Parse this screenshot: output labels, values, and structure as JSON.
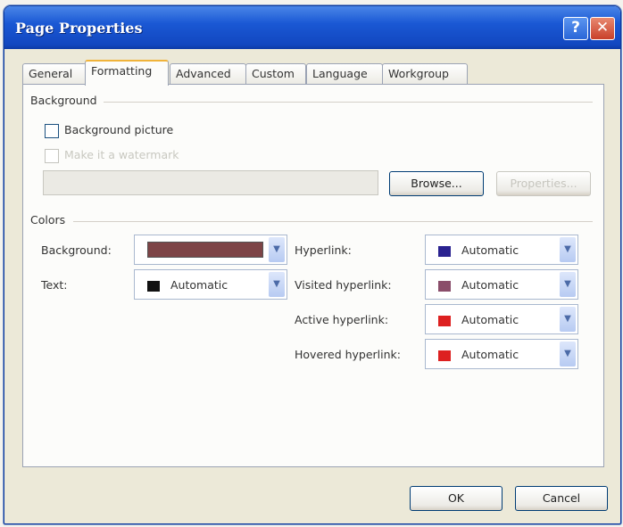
{
  "window": {
    "title": "Page Properties",
    "help": "?",
    "close": "✕"
  },
  "tabs": [
    "General",
    "Formatting",
    "Advanced",
    "Custom",
    "Language",
    "Workgroup"
  ],
  "active_tab": "Formatting",
  "background": {
    "group_label": "Background",
    "picture_checkbox": "Background picture",
    "watermark_checkbox": "Make it a watermark",
    "browse_button": "Browse...",
    "properties_button": "Properties..."
  },
  "colors": {
    "group_label": "Colors",
    "background_label": "Background:",
    "text_label": "Text:",
    "text_value": "Automatic",
    "hyperlink_label": "Hyperlink:",
    "hyperlink_value": "Automatic",
    "visited_label": "Visited hyperlink:",
    "visited_value": "Automatic",
    "active_label": "Active hyperlink:",
    "active_value": "Automatic",
    "hovered_label": "Hovered hyperlink:",
    "hovered_value": "Automatic",
    "swatches": {
      "background": "#7d4446",
      "text": "#111111",
      "hyperlink": "#2a2290",
      "visited": "#8a4d6a",
      "active": "#dd2020",
      "hovered": "#dd2020"
    }
  },
  "footer": {
    "ok": "OK",
    "cancel": "Cancel"
  }
}
